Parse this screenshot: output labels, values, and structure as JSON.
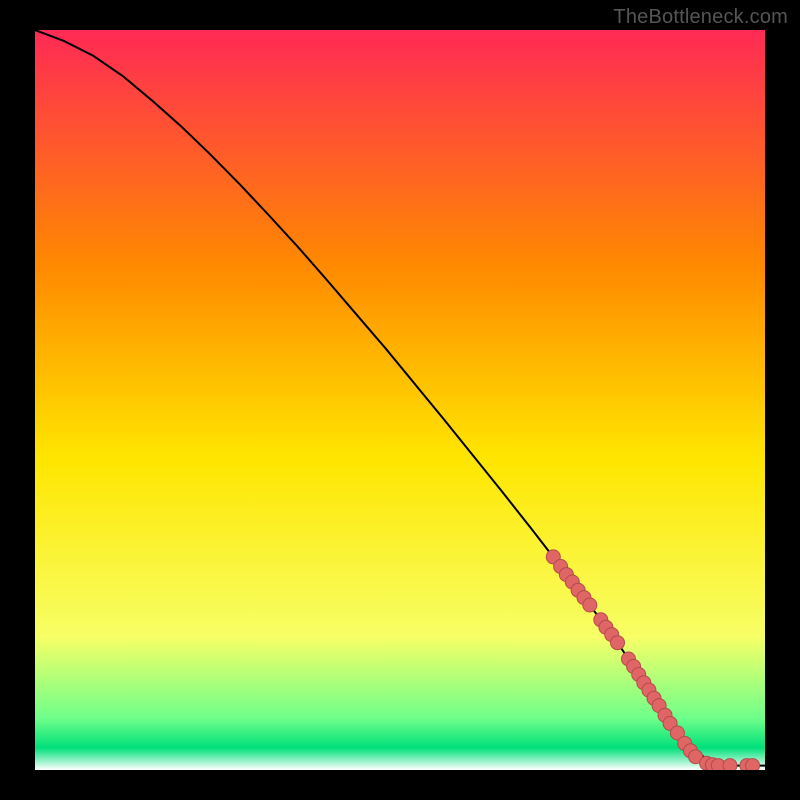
{
  "watermark": "TheBottleneck.com",
  "colors": {
    "background": "#000000",
    "curve": "#000000",
    "marker_fill": "#e06666",
    "marker_stroke": "#b44a4a",
    "grad_top": "#ff2a55",
    "grad_mid1": "#ff8a00",
    "grad_mid2": "#ffe600",
    "grad_mid3": "#f7ff66",
    "grad_green1": "#6fff8a",
    "grad_green2": "#00e07a",
    "grad_white": "#ffffff"
  },
  "chart_data": {
    "type": "line",
    "title": "",
    "xlabel": "",
    "ylabel": "",
    "xlim": [
      0,
      100
    ],
    "ylim": [
      0,
      100
    ],
    "grid": false,
    "series": [
      {
        "name": "curve",
        "x": [
          0,
          4,
          8,
          12,
          16,
          20,
          24,
          28,
          32,
          36,
          40,
          44,
          48,
          52,
          56,
          60,
          64,
          68,
          72,
          76,
          80,
          83,
          85,
          88,
          92,
          96,
          100
        ],
        "y": [
          100,
          98.5,
          96.5,
          93.8,
          90.5,
          87.0,
          83.2,
          79.2,
          75.0,
          70.7,
          66.2,
          61.6,
          57.0,
          52.2,
          47.4,
          42.5,
          37.6,
          32.6,
          27.5,
          22.3,
          16.9,
          12.5,
          9.5,
          5.0,
          1.4,
          0.6,
          0.6
        ]
      }
    ],
    "markers": {
      "comment": "salmon dot clusters overlaid on the lower-right portion of the curve",
      "points": [
        {
          "x": 71,
          "y": 28.8
        },
        {
          "x": 72,
          "y": 27.5
        },
        {
          "x": 72.8,
          "y": 26.4
        },
        {
          "x": 73.6,
          "y": 25.4
        },
        {
          "x": 74.4,
          "y": 24.3
        },
        {
          "x": 75.2,
          "y": 23.3
        },
        {
          "x": 76,
          "y": 22.3
        },
        {
          "x": 77.5,
          "y": 20.3
        },
        {
          "x": 78.2,
          "y": 19.3
        },
        {
          "x": 79,
          "y": 18.3
        },
        {
          "x": 79.8,
          "y": 17.2
        },
        {
          "x": 81.3,
          "y": 15.0
        },
        {
          "x": 82,
          "y": 14.0
        },
        {
          "x": 82.7,
          "y": 12.9
        },
        {
          "x": 83.4,
          "y": 11.8
        },
        {
          "x": 84.1,
          "y": 10.8
        },
        {
          "x": 84.8,
          "y": 9.7
        },
        {
          "x": 85.5,
          "y": 8.7
        },
        {
          "x": 86.3,
          "y": 7.4
        },
        {
          "x": 87,
          "y": 6.3
        },
        {
          "x": 88,
          "y": 5.0
        },
        {
          "x": 89,
          "y": 3.6
        },
        {
          "x": 89.8,
          "y": 2.6
        },
        {
          "x": 90.5,
          "y": 1.8
        },
        {
          "x": 92,
          "y": 0.9
        },
        {
          "x": 92.8,
          "y": 0.7
        },
        {
          "x": 93.6,
          "y": 0.6
        },
        {
          "x": 95.2,
          "y": 0.6
        },
        {
          "x": 97.5,
          "y": 0.6
        },
        {
          "x": 98.3,
          "y": 0.6
        }
      ]
    }
  }
}
